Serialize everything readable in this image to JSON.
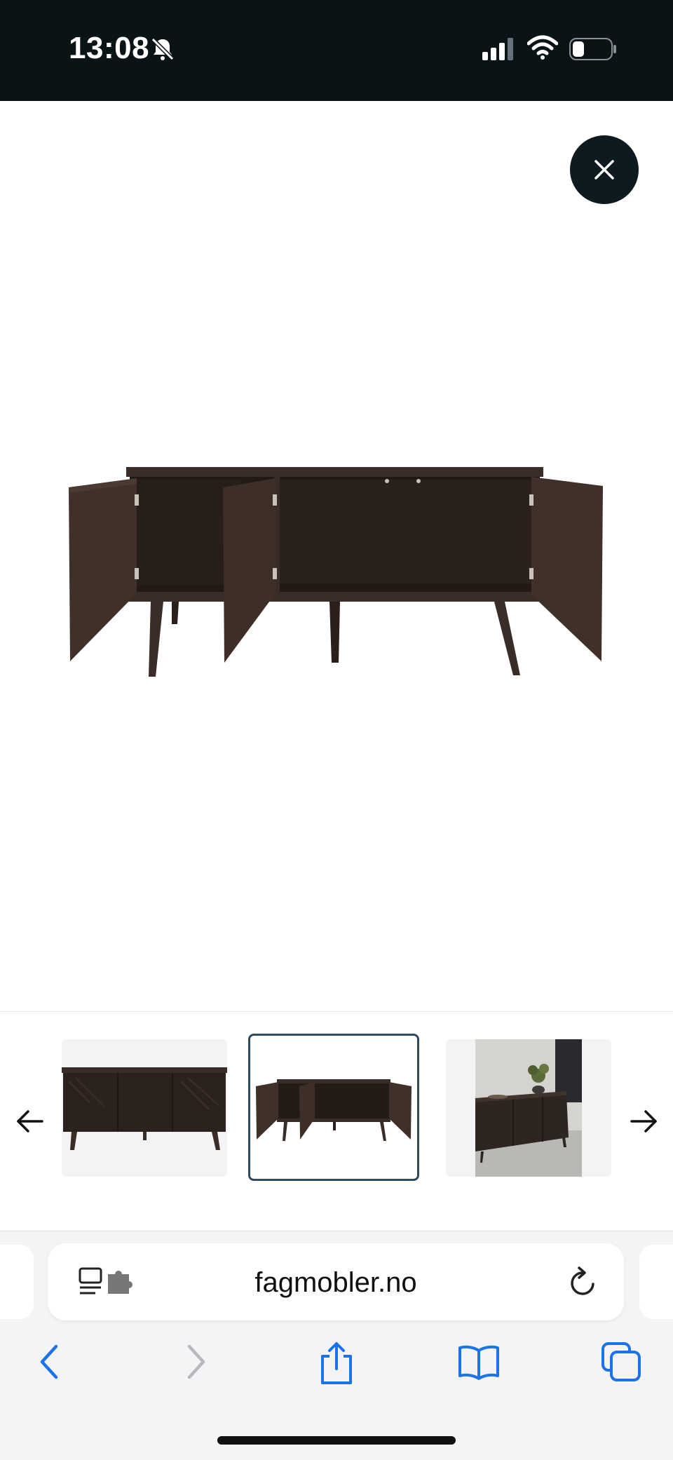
{
  "status_bar": {
    "time": "13:08",
    "icons": [
      "bell-slash-icon",
      "cellular-signal-icon",
      "wifi-icon",
      "battery-icon"
    ]
  },
  "viewer": {
    "close_icon": "close-icon",
    "main_image_alt": "Sideboard with doors open",
    "thumbnails": [
      {
        "name": "sideboard-front"
      },
      {
        "name": "sideboard-open",
        "selected": true
      },
      {
        "name": "sideboard-room"
      }
    ],
    "prev_icon": "arrow-left-icon",
    "next_icon": "arrow-right-icon"
  },
  "browser": {
    "url": "fagmobler.no",
    "toolbar": [
      "back-icon",
      "forward-icon",
      "share-icon",
      "bookmarks-icon",
      "tabs-icon"
    ]
  },
  "colors": {
    "status_bg": "#0a1316",
    "close_bg": "#0d1a1f",
    "selected_border": "#2f4c5a",
    "toolbar_blue": "#1a73e8",
    "wood": "#3a2d27"
  }
}
